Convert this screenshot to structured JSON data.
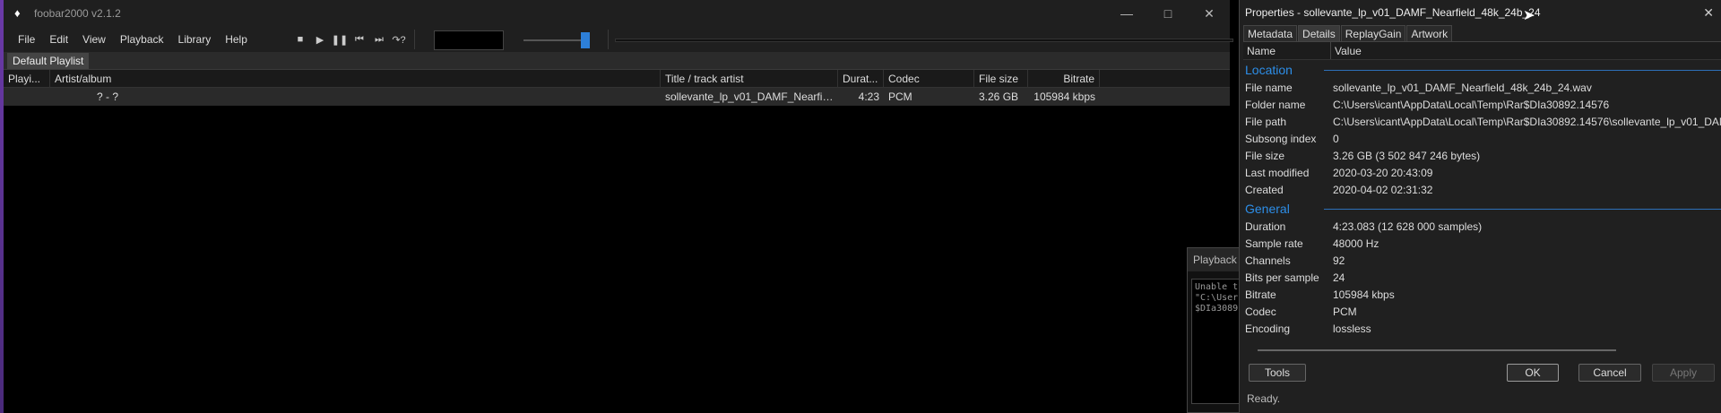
{
  "main": {
    "title": "foobar2000 v2.1.2",
    "menu": [
      "File",
      "Edit",
      "View",
      "Playback",
      "Library",
      "Help"
    ],
    "tab": "Default Playlist",
    "columns": [
      "Playi...",
      "Artist/album",
      "Title / track artist",
      "Durat...",
      "Codec",
      "File size",
      "Bitrate"
    ],
    "row": {
      "playing": "",
      "artist_album": "? - ?",
      "title": "sollevante_lp_v01_DAMF_Nearfield...",
      "duration": "4:23",
      "codec": "PCM",
      "file_size": "3.26 GB",
      "bitrate": "105984 kbps"
    },
    "volume_fraction": 0.95
  },
  "playback_error": {
    "title": "Playback e",
    "text": "Unable t\n\"C:\\User\n$DIa3089"
  },
  "properties": {
    "title": "Properties - sollevante_lp_v01_DAMF_Nearfield_48k_24b_24",
    "tabs": [
      "Metadata",
      "Details",
      "ReplayGain",
      "Artwork"
    ],
    "active_tab": "Details",
    "col_name": "Name",
    "col_value": "Value",
    "location_title": "Location",
    "location": [
      {
        "k": "File name",
        "v": "sollevante_lp_v01_DAMF_Nearfield_48k_24b_24.wav"
      },
      {
        "k": "Folder name",
        "v": "C:\\Users\\icant\\AppData\\Local\\Temp\\Rar$DIa30892.14576"
      },
      {
        "k": "File path",
        "v": "C:\\Users\\icant\\AppData\\Local\\Temp\\Rar$DIa30892.14576\\sollevante_lp_v01_DAMF_"
      },
      {
        "k": "Subsong index",
        "v": "0"
      },
      {
        "k": "File size",
        "v": "3.26 GB (3 502 847 246 bytes)"
      },
      {
        "k": "Last modified",
        "v": "2020-03-20 20:43:09"
      },
      {
        "k": "Created",
        "v": "2020-04-02 02:31:32"
      }
    ],
    "general_title": "General",
    "general": [
      {
        "k": "Duration",
        "v": "4:23.083 (12 628 000 samples)"
      },
      {
        "k": "Sample rate",
        "v": "48000 Hz"
      },
      {
        "k": "Channels",
        "v": "92"
      },
      {
        "k": "Bits per sample",
        "v": "24"
      },
      {
        "k": "Bitrate",
        "v": "105984 kbps"
      },
      {
        "k": "Codec",
        "v": "PCM"
      },
      {
        "k": "Encoding",
        "v": "lossless"
      }
    ],
    "buttons": {
      "tools": "Tools",
      "ok": "OK",
      "cancel": "Cancel",
      "apply": "Apply"
    },
    "status": "Ready."
  },
  "colors": {
    "accent": "#2d8ee8",
    "volume": "#2d7fd8"
  }
}
